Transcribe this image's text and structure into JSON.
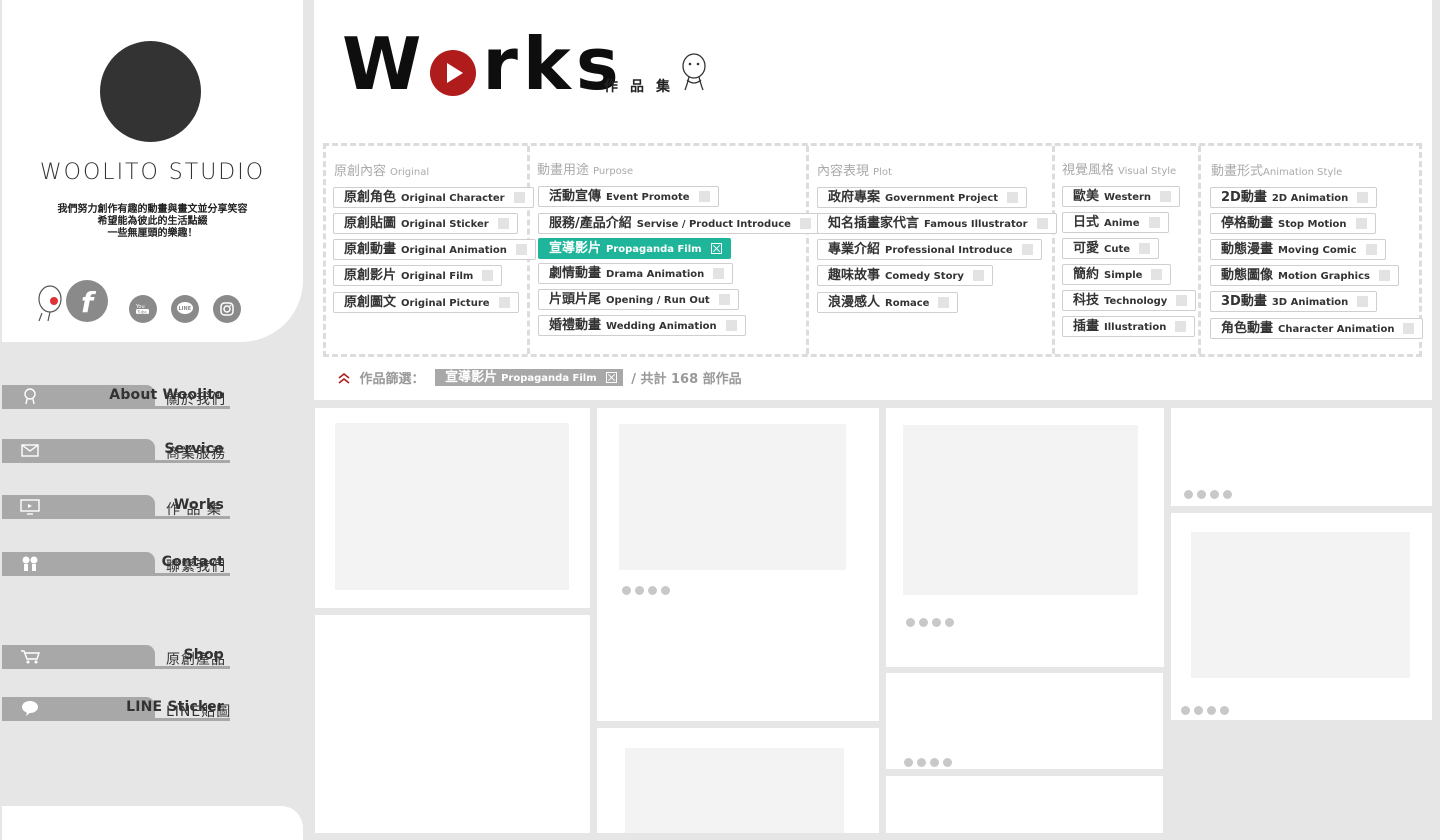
{
  "sidebar": {
    "studio_name": "WOOLITO STUDIO",
    "tagline": [
      "我們努力創作有趣的動畫與畫文並分享笑容",
      "希望能為彼此的生活點綴",
      "一些無厘頭的樂趣！"
    ],
    "social": [
      {
        "icon": "facebook-icon",
        "label": "f"
      },
      {
        "icon": "youtube-icon",
        "label": "You Tube"
      },
      {
        "icon": "line-icon",
        "label": "LINE"
      },
      {
        "icon": "instagram-icon",
        "label": ""
      }
    ],
    "nav": [
      {
        "en": "About Woolito",
        "zh": "關於我們",
        "icon": "mascot-icon"
      },
      {
        "en": "Service",
        "zh": "商業服務",
        "icon": "envelope-icon"
      },
      {
        "en": "Works",
        "zh": "作 品 集",
        "icon": "monitor-icon"
      },
      {
        "en": "Contact",
        "zh": "聯繫我們",
        "icon": "people-icon"
      },
      {
        "en": "Shop",
        "zh": "原創產品",
        "icon": "cart-icon"
      },
      {
        "en": "LINE Sticker",
        "zh": "LINE貼圖",
        "icon": "speech-bubble-icon"
      }
    ]
  },
  "header": {
    "title_w": "W",
    "title_rest": "rks",
    "subtitle": "作品集"
  },
  "filters": [
    {
      "zh": "原創內容",
      "en": "Original",
      "tags": [
        {
          "zh": "原創角色",
          "en": "Original Character"
        },
        {
          "zh": "原創貼圖",
          "en": "Original Sticker"
        },
        {
          "zh": "原創動畫",
          "en": "Original Animation"
        },
        {
          "zh": "原創影片",
          "en": "Original Film"
        },
        {
          "zh": "原創圖文",
          "en": "Original Picture"
        }
      ]
    },
    {
      "zh": "動畫用途",
      "en": "Purpose",
      "tags": [
        {
          "zh": "活動宣傳",
          "en": "Event Promote"
        },
        {
          "zh": "服務/產品介紹",
          "en": "Servise / Product Introduce"
        },
        {
          "zh": "宣導影片",
          "en": "Propaganda Film",
          "active": true
        },
        {
          "zh": "劇情動畫",
          "en": "Drama Animation"
        },
        {
          "zh": "片頭片尾",
          "en": "Opening / Run Out"
        },
        {
          "zh": "婚禮動畫",
          "en": "Wedding Animation"
        }
      ]
    },
    {
      "zh": "內容表現",
      "en": "Plot",
      "tags": [
        {
          "zh": "政府專案",
          "en": "Government Project"
        },
        {
          "zh": "知名插畫家代言",
          "en": "Famous Illustrator"
        },
        {
          "zh": "專業介紹",
          "en": "Professional Introduce"
        },
        {
          "zh": "趣味故事",
          "en": "Comedy Story"
        },
        {
          "zh": "浪漫感人",
          "en": "Romace"
        }
      ]
    },
    {
      "zh": "視覺風格",
      "en": "Visual Style",
      "tags": [
        {
          "zh": "歐美",
          "en": "Western"
        },
        {
          "zh": "日式",
          "en": "Anime"
        },
        {
          "zh": "可愛",
          "en": "Cute"
        },
        {
          "zh": "簡約",
          "en": "Simple"
        },
        {
          "zh": "科技",
          "en": "Technology"
        },
        {
          "zh": "插畫",
          "en": "Illustration"
        }
      ]
    },
    {
      "zh": "動畫形式",
      "en": "Animation Style",
      "tags": [
        {
          "zh": "2D動畫",
          "en": "2D Animation"
        },
        {
          "zh": "停格動畫",
          "en": "Stop Motion"
        },
        {
          "zh": "動態漫畫",
          "en": "Moving Comic"
        },
        {
          "zh": "動態圖像",
          "en": "Motion Graphics"
        },
        {
          "zh": "3D動畫",
          "en": "3D Animation"
        },
        {
          "zh": "角色動畫",
          "en": "Character Animation"
        }
      ]
    }
  ],
  "selection": {
    "label": "作品篩選：",
    "tag_zh": "宣導影片",
    "tag_en": "Propaganda Film",
    "count_text": "/ 共計 168 部作品"
  },
  "colors": {
    "accent": "#1fb59a",
    "brand_red": "#b01c1c",
    "nav_tab": "#a8a8a8"
  }
}
